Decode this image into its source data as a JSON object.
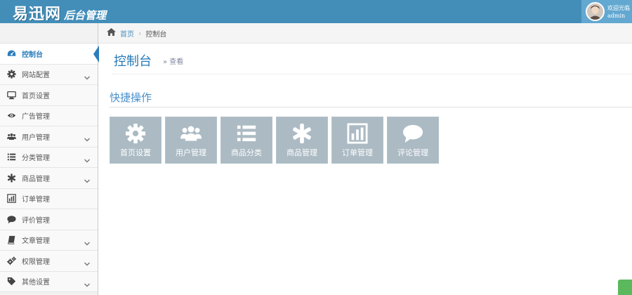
{
  "header": {
    "logo_main": "易迅网",
    "logo_sub": "后台管理",
    "welcome": "欢迎光临",
    "username": "admin"
  },
  "breadcrumb": {
    "home": "首页",
    "current": "控制台"
  },
  "sidebar": {
    "items": [
      {
        "label": "控制台",
        "icon": "dashboard-icon",
        "active": true,
        "has_submenu": false
      },
      {
        "label": "网站配置",
        "icon": "gear-icon",
        "active": false,
        "has_submenu": true
      },
      {
        "label": "首页设置",
        "icon": "monitor-icon",
        "active": false,
        "has_submenu": false
      },
      {
        "label": "广告管理",
        "icon": "eye-icon",
        "active": false,
        "has_submenu": false
      },
      {
        "label": "用户管理",
        "icon": "users-icon",
        "active": false,
        "has_submenu": true
      },
      {
        "label": "分类管理",
        "icon": "list-icon",
        "active": false,
        "has_submenu": true
      },
      {
        "label": "商品管理",
        "icon": "asterisk-icon",
        "active": false,
        "has_submenu": true
      },
      {
        "label": "订单管理",
        "icon": "bar-chart-icon",
        "active": false,
        "has_submenu": false
      },
      {
        "label": "评价管理",
        "icon": "comment-icon",
        "active": false,
        "has_submenu": false
      },
      {
        "label": "文章管理",
        "icon": "book-icon",
        "active": false,
        "has_submenu": true
      },
      {
        "label": "权限管理",
        "icon": "cogs-icon",
        "active": false,
        "has_submenu": true
      },
      {
        "label": "其他设置",
        "icon": "tag-icon",
        "active": false,
        "has_submenu": true
      }
    ]
  },
  "main": {
    "page_title": "控制台",
    "page_subtitle": "» 查看",
    "section_title": "快捷操作",
    "shortcuts": [
      {
        "label": "首页设置",
        "icon": "gear-icon"
      },
      {
        "label": "用户管理",
        "icon": "users-icon"
      },
      {
        "label": "商品分类",
        "icon": "list-icon"
      },
      {
        "label": "商品管理",
        "icon": "asterisk-icon"
      },
      {
        "label": "订单管理",
        "icon": "bar-chart-icon"
      },
      {
        "label": "评论管理",
        "icon": "comment-icon"
      }
    ]
  },
  "colors": {
    "topbar": "#438eb9",
    "accent": "#2b7dbc",
    "shortcut_bg": "#abbac3"
  }
}
